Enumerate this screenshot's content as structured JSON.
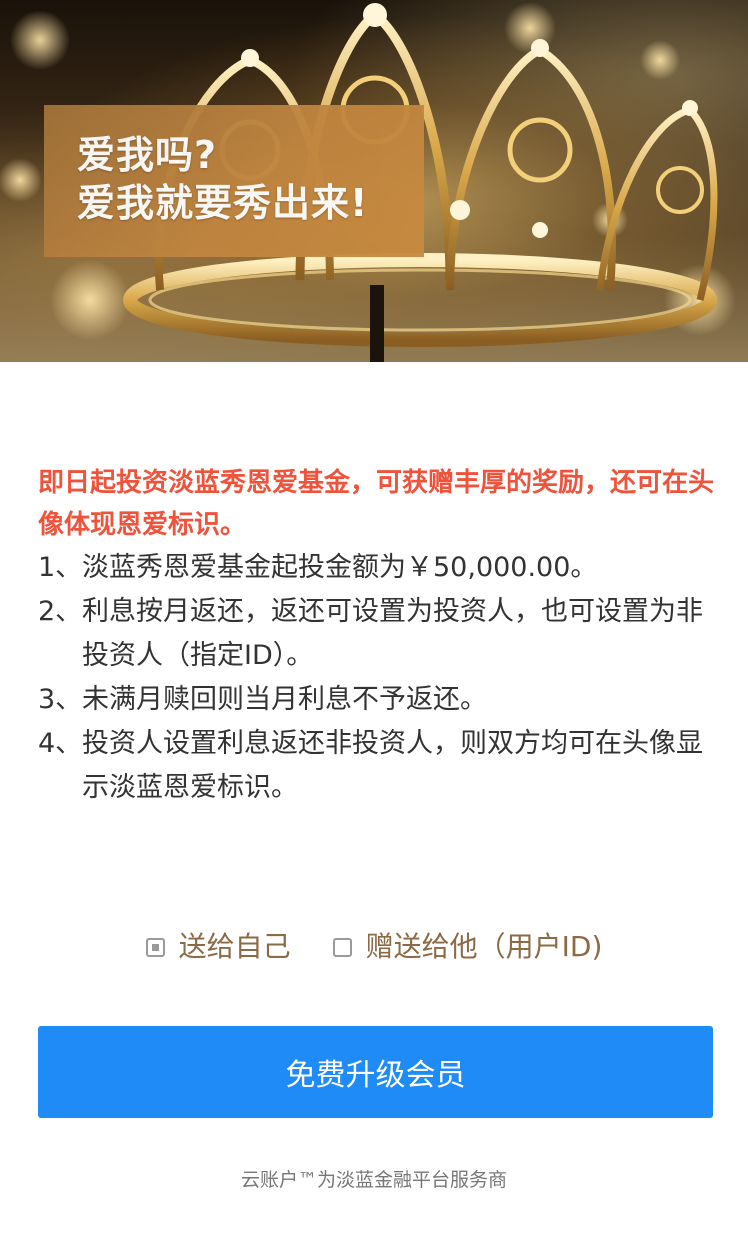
{
  "banner": {
    "headline_lines": [
      "爱我吗?",
      "爱我就要秀出来!"
    ]
  },
  "promo_text": "即日起投资淡蓝秀恩爱基金，可获赠丰厚的奖励，还可在头像体现恩爱标识。",
  "rules": [
    {
      "num": "1、",
      "text": "淡蓝秀恩爱基金起投金额为￥50,000.00。"
    },
    {
      "num": "2、",
      "text": "利息按月返还，返还可设置为投资人，也可设置为非投资人（指定ID）。"
    },
    {
      "num": "3、",
      "text": "未满月赎回则当月利息不予返还。"
    },
    {
      "num": "4、",
      "text": "投资人设置利息返还非投资人，则双方均可在头像显示淡蓝恩爱标识。"
    }
  ],
  "options": [
    {
      "label": "送给自己",
      "checked": true
    },
    {
      "label": "赠送给他（用户ID)",
      "checked": false
    }
  ],
  "primary_button": "免费升级会员",
  "footer": "云账户™为淡蓝金融平台服务商",
  "colors": {
    "accent": "#1e8bf7",
    "promo": "#f0533b",
    "option_text": "#8b6a45",
    "headline_box": "#b07a3c"
  }
}
